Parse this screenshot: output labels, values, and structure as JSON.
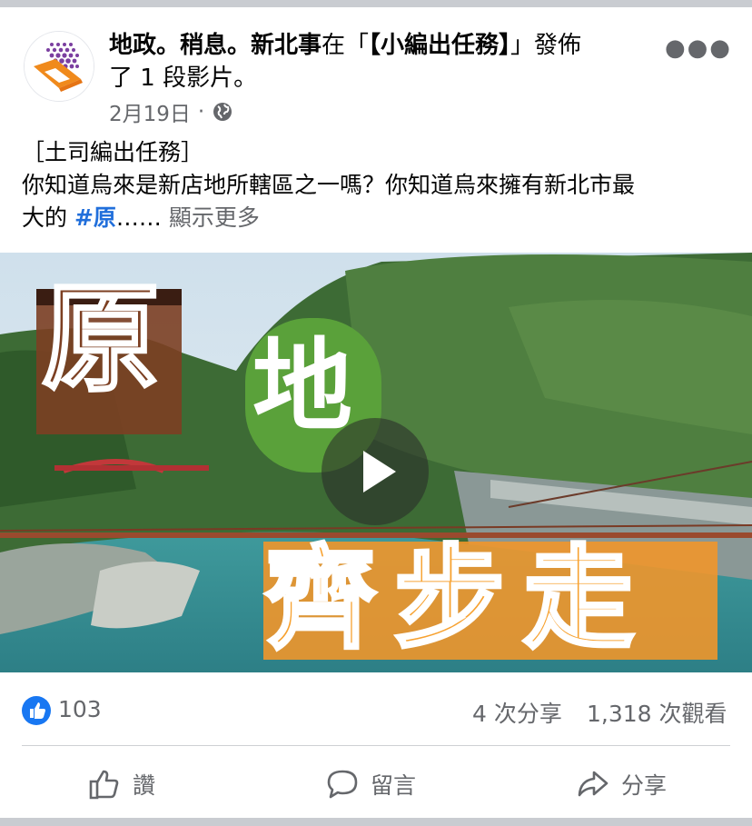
{
  "post": {
    "page_name": "地政。稍息。新北事",
    "title_mid": "在「",
    "title_group": "【小編出任務】",
    "title_end_1": "」發佈",
    "title_end_2": "了 1 段影片。",
    "date": "2月19日",
    "dot": "·",
    "text_line1": "［土司編出任務］",
    "text_line2": "你知道烏來是新店地所轄區之一嗎？你知道烏來擁有新北市最",
    "text_line3_prefix": "大的 ",
    "hashtag": "#原",
    "ellipsis": "……",
    "see_more": "顯示更多"
  },
  "video": {
    "overlay_char_1": "原",
    "overlay_char_2": "地",
    "overlay_chars_3": "齊步走"
  },
  "stats": {
    "likes": "103",
    "shares": "4 次分享",
    "views": "1,318 次觀看"
  },
  "actions": {
    "like": "讚",
    "comment": "留言",
    "share": "分享"
  },
  "colors": {
    "accent": "#1877f2",
    "hashtag": "#216fdb",
    "muted": "#65676b"
  }
}
